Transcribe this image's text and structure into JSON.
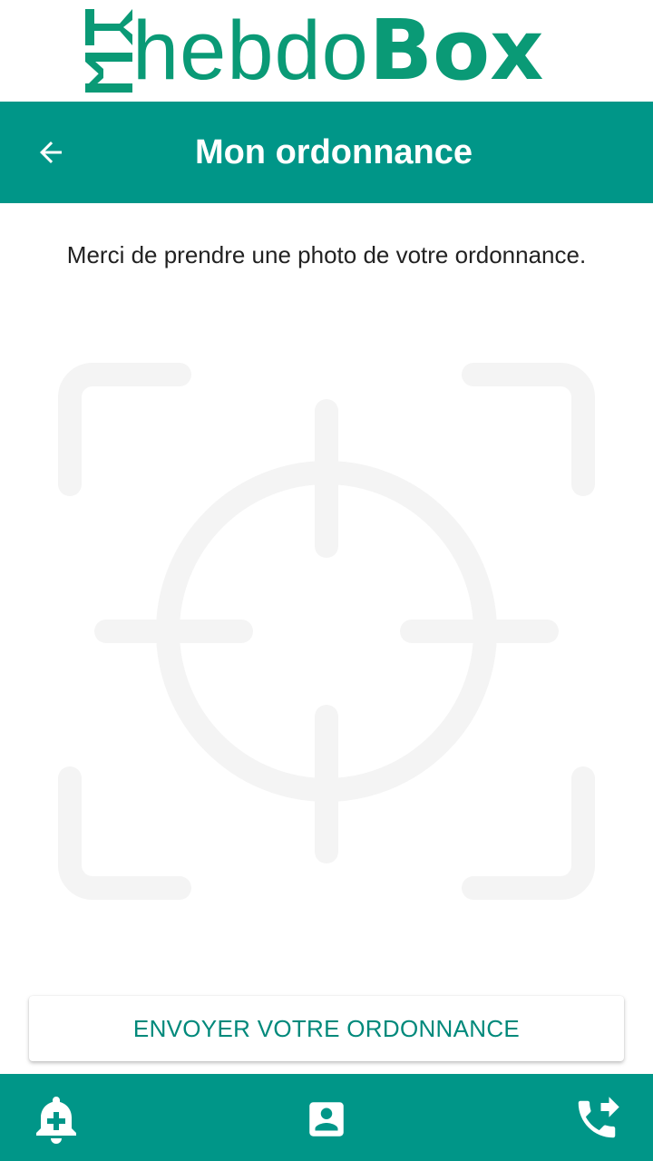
{
  "logo": {
    "my": "MY",
    "hebdo": "hebdo",
    "box": "Box"
  },
  "appbar": {
    "title": "Mon ordonnance",
    "back_icon": "arrow-back-icon"
  },
  "main": {
    "instruction": "Merci de prendre une photo de votre ordonnance.",
    "scanner_icon": "camera-target-icon",
    "send_button_label": "ENVOYER VOTRE ORDONNANCE"
  },
  "bottom_nav": {
    "items": [
      {
        "icon": "medical-alert-bell-icon"
      },
      {
        "icon": "account-box-icon"
      },
      {
        "icon": "phone-forwarded-icon"
      }
    ]
  },
  "colors": {
    "brand": "#009688",
    "logo": "#0a9a76",
    "button_text": "#00897b"
  }
}
